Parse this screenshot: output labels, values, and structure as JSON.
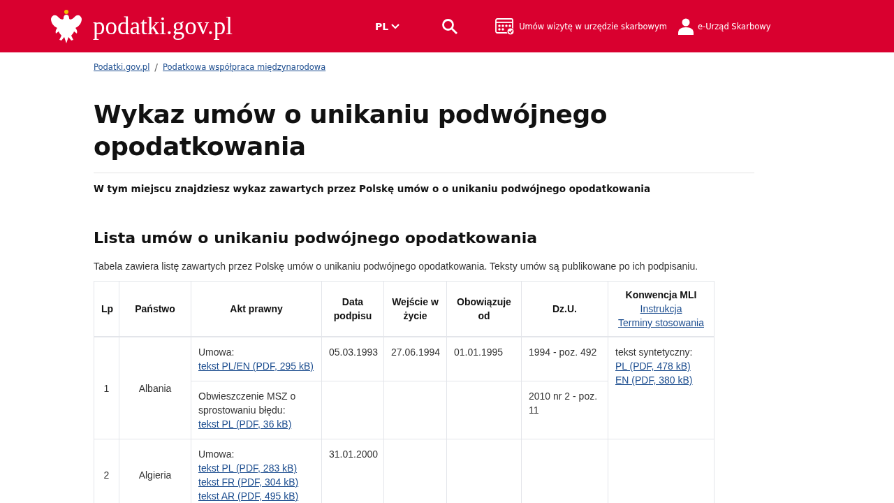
{
  "header": {
    "logo": "podatki.gov.pl",
    "language": "PL",
    "links": [
      {
        "kind": "calendar",
        "label": "Umów wizytę w urzędzie skarbowym"
      },
      {
        "kind": "user",
        "label": "e-Urząd Skarbowy"
      }
    ]
  },
  "breadcrumbs": [
    "Podatki.gov.pl",
    "Podatkowa współpraca międzynarodowa"
  ],
  "breadcrumb_separator": "/",
  "title": "Wykaz umów o unikaniu podwójnego opodatkowania",
  "lead": "W tym miejscu znajdziesz wykaz zawartych przez Polskę umów o o unikaniu podwójnego opodatkowania",
  "section_title": "Lista umów o unikaniu podwójnego opodatkowania",
  "table_caption": "Tabela zawiera listę zawartych przez Polskę umów o unikaniu podwójnego opodatkowania. Teksty umów są publikowane po ich podpisaniu.",
  "table": {
    "columns": [
      {
        "label": "Lp"
      },
      {
        "label": "Państwo"
      },
      {
        "label": "Akt prawny"
      },
      {
        "label": "Data podpisu"
      },
      {
        "label": "Wejście w życie"
      },
      {
        "label": "Obowiązuje od"
      },
      {
        "label": "Dz.U."
      },
      {
        "label": "Konwencja MLI",
        "links": [
          "Instrukcja",
          "Terminy stosowania"
        ]
      }
    ],
    "rows": [
      {
        "lp": "1",
        "country": "Albania",
        "acts": [
          {
            "label": "Umowa:",
            "links": [
              "tekst PL/EN (PDF, 295 kB)"
            ],
            "signed": "05.03.1993",
            "in_force": "27.06.1994",
            "applies_from": "01.01.1995",
            "journal": "1994 - poz. 492"
          },
          {
            "label": "Obwieszczenie MSZ o sprostowaniu błędu:",
            "links": [
              "tekst PL (PDF, 36 kB)"
            ],
            "journal": "2010 nr 2 - poz. 11"
          }
        ],
        "mli": {
          "label": "tekst syntetyczny:",
          "links": [
            "PL (PDF, 478 kB)",
            "EN (PDF, 380 kB)"
          ]
        }
      },
      {
        "lp": "2",
        "country": "Algieria",
        "acts": [
          {
            "label": "Umowa:",
            "links": [
              "tekst PL (PDF, 283 kB)",
              "tekst FR (PDF, 304 kB)",
              "tekst AR (PDF, 495 kB)"
            ],
            "signed": "31.01.2000"
          }
        ]
      }
    ]
  }
}
